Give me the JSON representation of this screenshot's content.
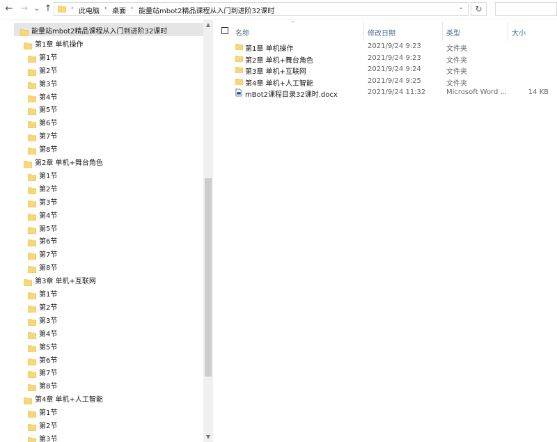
{
  "nav": {
    "back": "←",
    "forward": "→",
    "recent": "⌄",
    "up": "↑",
    "refresh": "↻",
    "dropdown": "⌄"
  },
  "address": {
    "crumbs": [
      "此电脑",
      "桌面",
      "能量站mbot2精品课程从入门到进阶32课时"
    ],
    "separator": "›"
  },
  "tree": {
    "root": "能量站mbot2精品课程从入门到进阶32课时",
    "chapters": [
      {
        "label": "第1章 单机操作",
        "sections": [
          "第1节",
          "第2节",
          "第3节",
          "第4节",
          "第5节",
          "第6节",
          "第7节",
          "第8节"
        ]
      },
      {
        "label": "第2章 单机+舞台角色",
        "sections": [
          "第1节",
          "第2节",
          "第3节",
          "第4节",
          "第5节",
          "第6节",
          "第7节",
          "第8节"
        ]
      },
      {
        "label": "第3章 单机+互联网",
        "sections": [
          "第1节",
          "第2节",
          "第3节",
          "第4节",
          "第5节",
          "第6节",
          "第7节",
          "第8节"
        ]
      },
      {
        "label": "第4章 单机+人工智能",
        "sections": [
          "第1节",
          "第2节",
          "第3节"
        ]
      }
    ]
  },
  "columns": {
    "name": "名称",
    "date": "修改日期",
    "type": "类型",
    "size": "大小"
  },
  "files": [
    {
      "icon": "folder-icon",
      "name": "第1章 单机操作",
      "date": "2021/9/24 9:23",
      "type": "文件夹",
      "size": ""
    },
    {
      "icon": "folder-icon",
      "name": "第2章 单机+舞台角色",
      "date": "2021/9/24 9:23",
      "type": "文件夹",
      "size": ""
    },
    {
      "icon": "folder-icon",
      "name": "第3章 单机+互联网",
      "date": "2021/9/24 9:24",
      "type": "文件夹",
      "size": ""
    },
    {
      "icon": "folder-icon",
      "name": "第4章 单机+人工智能",
      "date": "2021/9/24 9:25",
      "type": "文件夹",
      "size": ""
    },
    {
      "icon": "word-doc-icon",
      "name": "mBot2课程目录32课时.docx",
      "date": "2021/9/24 11:32",
      "type": "Microsoft Word ...",
      "size": "14 KB"
    }
  ],
  "colors": {
    "folder": "#f8d776",
    "folder_edge": "#e3b64a",
    "selected": "#e5e5e5",
    "header_text": "#4d6a8a",
    "word_blue": "#2b579a"
  }
}
